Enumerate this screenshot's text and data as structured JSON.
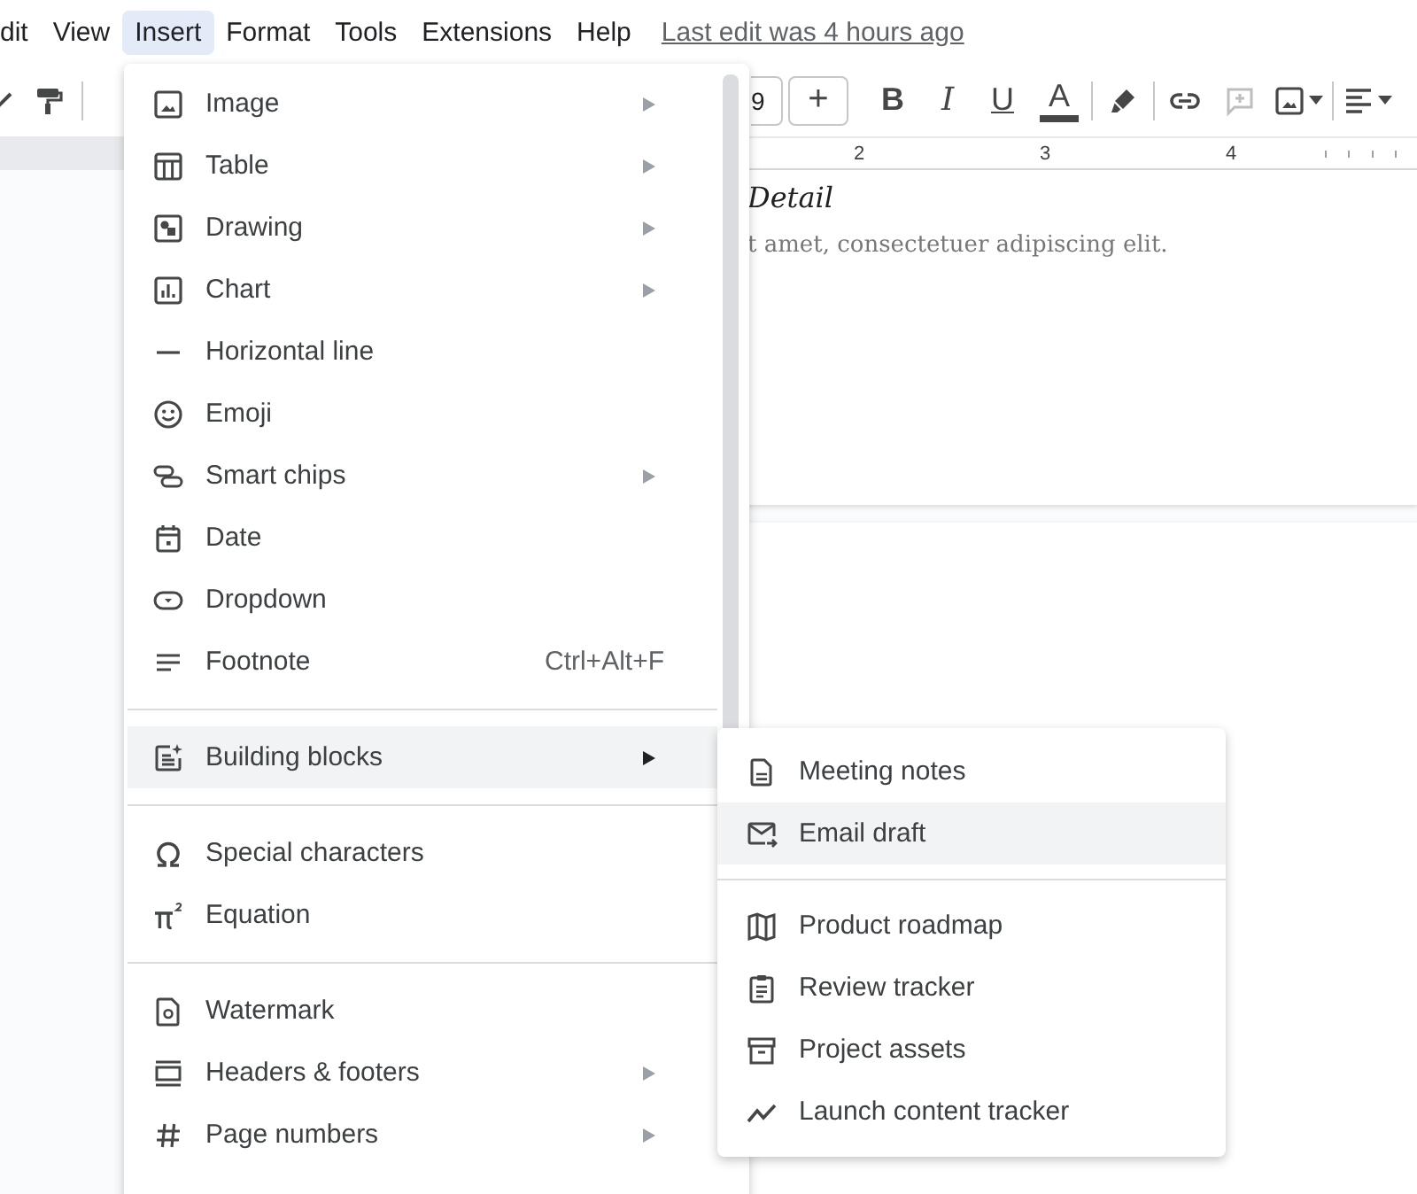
{
  "menubar": {
    "items": [
      {
        "label": "dit",
        "selected": false
      },
      {
        "label": "View",
        "selected": false
      },
      {
        "label": "Insert",
        "selected": true
      },
      {
        "label": "Format",
        "selected": false
      },
      {
        "label": "Tools",
        "selected": false
      },
      {
        "label": "Extensions",
        "selected": false
      },
      {
        "label": "Help",
        "selected": false
      }
    ],
    "last_edit": "Last edit was 4 hours ago"
  },
  "toolbar": {
    "font_size": "9",
    "buttons": [
      {
        "kind": "plus",
        "label": "+",
        "disabled": false
      },
      {
        "kind": "bold",
        "label": "B",
        "disabled": false
      },
      {
        "kind": "italic",
        "label": "I",
        "disabled": false
      },
      {
        "kind": "underline",
        "label": "U",
        "disabled": false
      },
      {
        "kind": "text-color",
        "label": "A",
        "disabled": false
      },
      {
        "kind": "highlight",
        "disabled": false
      },
      {
        "kind": "link",
        "disabled": false
      },
      {
        "kind": "comment",
        "disabled": true
      },
      {
        "kind": "image",
        "disabled": false
      },
      {
        "kind": "align",
        "disabled": false
      }
    ]
  },
  "ruler": {
    "labels": [
      "2",
      "3",
      "4"
    ]
  },
  "document": {
    "heading": "Detail",
    "body": "t amet, consectetuer adipiscing elit."
  },
  "insert_menu": {
    "groups": [
      {
        "items": [
          {
            "label": "Image",
            "submenu": true,
            "selected": false
          },
          {
            "label": "Table",
            "submenu": true,
            "selected": false
          },
          {
            "label": "Drawing",
            "submenu": true,
            "selected": false
          },
          {
            "label": "Chart",
            "submenu": true,
            "selected": false
          },
          {
            "label": "Horizontal line",
            "submenu": false,
            "selected": false
          },
          {
            "label": "Emoji",
            "submenu": false,
            "selected": false
          },
          {
            "label": "Smart chips",
            "submenu": true,
            "selected": false
          },
          {
            "label": "Date",
            "submenu": false,
            "selected": false
          },
          {
            "label": "Dropdown",
            "submenu": false,
            "selected": false
          },
          {
            "label": "Footnote",
            "submenu": false,
            "selected": false,
            "shortcut": "Ctrl+Alt+F"
          }
        ]
      },
      {
        "items": [
          {
            "label": "Building blocks",
            "submenu": true,
            "selected": true
          }
        ]
      },
      {
        "items": [
          {
            "label": "Special characters",
            "submenu": false,
            "selected": false
          },
          {
            "label": "Equation",
            "submenu": false,
            "selected": false
          }
        ]
      },
      {
        "items": [
          {
            "label": "Watermark",
            "submenu": false,
            "selected": false
          },
          {
            "label": "Headers & footers",
            "submenu": true,
            "selected": false
          },
          {
            "label": "Page numbers",
            "submenu": true,
            "selected": false
          }
        ]
      }
    ]
  },
  "building_blocks_menu": {
    "groups": [
      {
        "items": [
          {
            "label": "Meeting notes",
            "selected": false
          },
          {
            "label": "Email draft",
            "selected": true
          }
        ]
      },
      {
        "items": [
          {
            "label": "Product roadmap",
            "selected": false
          },
          {
            "label": "Review tracker",
            "selected": false
          },
          {
            "label": "Project assets",
            "selected": false
          },
          {
            "label": "Launch content tracker",
            "selected": false
          }
        ]
      }
    ]
  }
}
